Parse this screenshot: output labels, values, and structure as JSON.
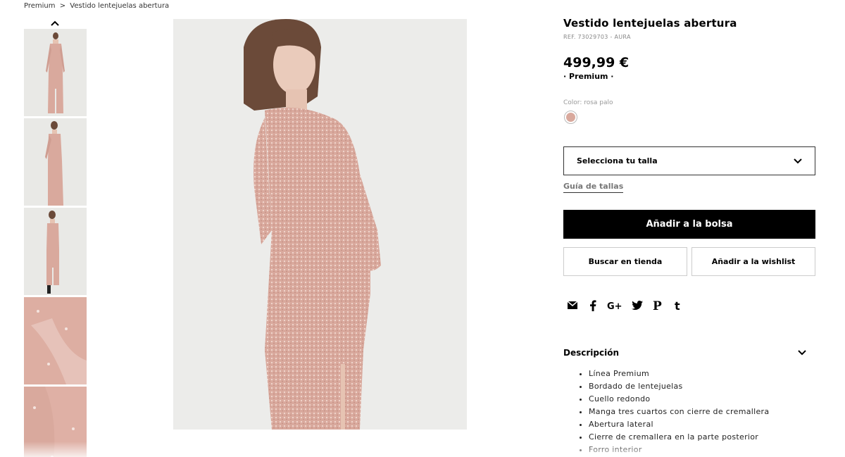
{
  "breadcrumb": {
    "parent": "Premium",
    "separator": ">",
    "current": "Vestido lentejuelas abertura"
  },
  "product": {
    "title": "Vestido lentejuelas abertura",
    "ref": "REF. 73029703 - AURA",
    "price": "499,99 €",
    "collection": "· Premium ·",
    "color_label": "Color: rosa palo",
    "swatch_color": "#d9a99d"
  },
  "size_select": {
    "label": "Selecciona tu talla",
    "icon": "chevron-down-icon"
  },
  "size_guide": "Guía de tallas",
  "buttons": {
    "add_to_bag": "Añadir a la bolsa",
    "find_in_store": "Buscar en tienda",
    "add_to_wishlist": "Añadir a la wishlist"
  },
  "share_icons": [
    "email-icon",
    "facebook-icon",
    "google-plus-icon",
    "twitter-icon",
    "pinterest-icon",
    "tumblr-icon"
  ],
  "description": {
    "label": "Descripción",
    "items": [
      "Línea Premium",
      "Bordado de lentejuelas",
      "Cuello redondo",
      "Manga tres cuartos con cierre de cremallera",
      "Abertura lateral",
      "Cierre de cremallera en la parte posterior",
      "Forro interior"
    ]
  },
  "colors": {
    "dress": "#d9a99d",
    "background": "#ececea",
    "button": "#000000"
  }
}
